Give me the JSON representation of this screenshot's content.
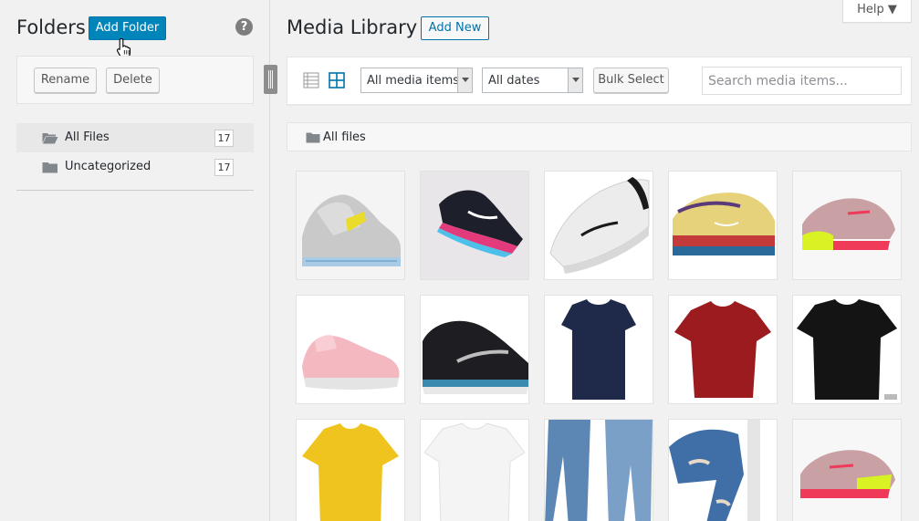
{
  "sidebar": {
    "title": "Folders",
    "add_folder_label": "Add Folder",
    "help_symbol": "?",
    "rename_label": "Rename",
    "delete_label": "Delete",
    "folders": [
      {
        "name": "All Files",
        "count": "17",
        "icon": "folder-open-icon"
      },
      {
        "name": "Uncategorized",
        "count": "17",
        "icon": "folder-icon"
      }
    ]
  },
  "header": {
    "title": "Media Library",
    "add_new_label": "Add New",
    "help_label": "Help ▼"
  },
  "toolbar": {
    "view_list_icon": "list-view-icon",
    "view_grid_icon": "grid-view-icon",
    "media_type_filter": "All media items",
    "date_filter": "All dates",
    "bulk_select_label": "Bulk Select",
    "search_placeholder": "Search media items..."
  },
  "breadcrumb": {
    "label": "All files"
  },
  "media": [
    {
      "kind": "sneaker-gray-yellow"
    },
    {
      "kind": "sneaker-black-rainbow"
    },
    {
      "kind": "sneaker-white"
    },
    {
      "kind": "sneaker-yellow-multicolor"
    },
    {
      "kind": "sneaker-pink-neon"
    },
    {
      "kind": "sneaker-pink-knit"
    },
    {
      "kind": "sneaker-black-blue"
    },
    {
      "kind": "tshirt-navy",
      "color": "#1f2a4a"
    },
    {
      "kind": "tshirt-red",
      "color": "#9b1b1f"
    },
    {
      "kind": "tshirt-black",
      "color": "#141414"
    },
    {
      "kind": "tshirt-yellow",
      "color": "#f0c41e"
    },
    {
      "kind": "tshirt-white",
      "color": "#f7f7f7"
    },
    {
      "kind": "jeans-blue"
    },
    {
      "kind": "jeans-ripped"
    },
    {
      "kind": "sneaker-pink-neon-2"
    }
  ],
  "colors": {
    "accent": "#0085ba",
    "link": "#0073aa"
  }
}
